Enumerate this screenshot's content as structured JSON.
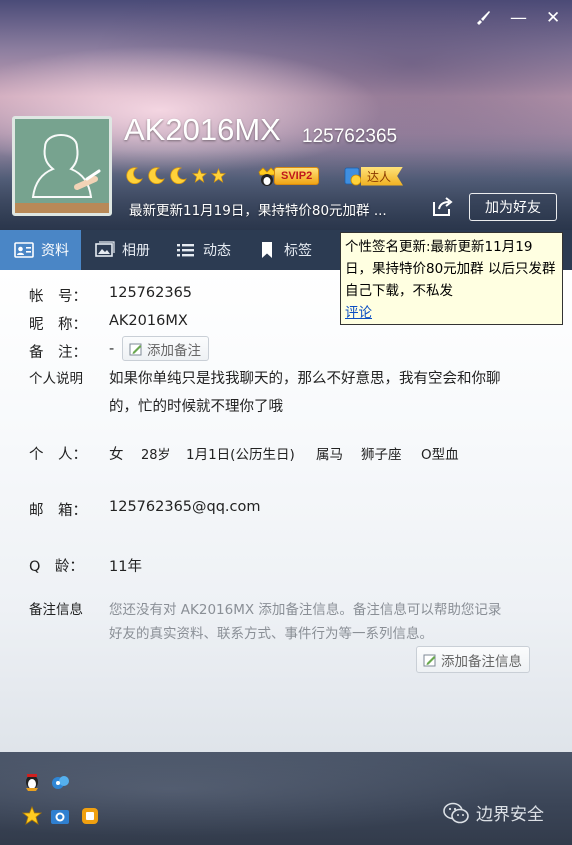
{
  "window": {
    "controls": {
      "skin_icon": "brush-icon",
      "minimize": "—",
      "close": "✕"
    }
  },
  "profile": {
    "nickname": "AK2016MX",
    "qq_number": "125762365",
    "avatar_icon": "default-avatar-chalkboard-icon",
    "level_icons": [
      "moon",
      "moon",
      "moon",
      "star",
      "star"
    ],
    "vip_badge": "SVIP2",
    "daren_badge": "达人",
    "signature": "最新更新11月19日，果持特价80元加群 ...",
    "add_friend_label": "加为好友"
  },
  "tabs": [
    {
      "label": "资料",
      "icon": "profile-card-icon",
      "active": true
    },
    {
      "label": "相册",
      "icon": "photo-icon",
      "active": false
    },
    {
      "label": "动态",
      "icon": "list-icon",
      "active": false
    },
    {
      "label": "标签",
      "icon": "bookmark-icon",
      "active": false
    }
  ],
  "tooltip": {
    "text": "个性签名更新:最新更新11月19日，果持特价80元加群 以后只发群自己下载，不私发",
    "link": "评论"
  },
  "info": {
    "account_label": "帐　号：",
    "account_value": "125762365",
    "nickname_label": "昵　称：",
    "nickname_value": "AK2016MX",
    "remark_label": "备　注：",
    "remark_value": "-",
    "add_remark_button": "添加备注",
    "bio_label": "个人说明",
    "bio_line1": "如果你单纯只是找我聊天的，那么不好意思，我有空会和你聊",
    "bio_line2": "的，忙的时候就不理你了哦",
    "personal_label": "个　人：",
    "gender": "女",
    "age": "28岁",
    "birthday": "1月1日(公历生日)",
    "zodiac": "属马",
    "constellation": "狮子座",
    "blood_type": "O型血",
    "email_label": "邮　箱：",
    "email_value": "125762365@qq.com",
    "qage_label": "Q　龄：",
    "qage_value": "11年",
    "remark_info_label": "备注信息",
    "remark_info_line1": "您还没有对 AK2016MX 添加备注信息。备注信息可以帮助您记录",
    "remark_info_line2": "好友的真实资料、联系方式、事件行为等一系列信息。",
    "add_remark_info_button": "添加备注信息"
  },
  "footer": {
    "icons": [
      "qq-penguin-icon",
      "qq-music-icon",
      "star-badge-icon",
      "camera-icon",
      "game-icon"
    ],
    "watermark": "边界安全"
  },
  "colors": {
    "tab_bar": "#2c3b52",
    "tab_active": "#4a86c6",
    "tooltip_bg": "#ffffe1",
    "link": "#0b4fc3"
  }
}
